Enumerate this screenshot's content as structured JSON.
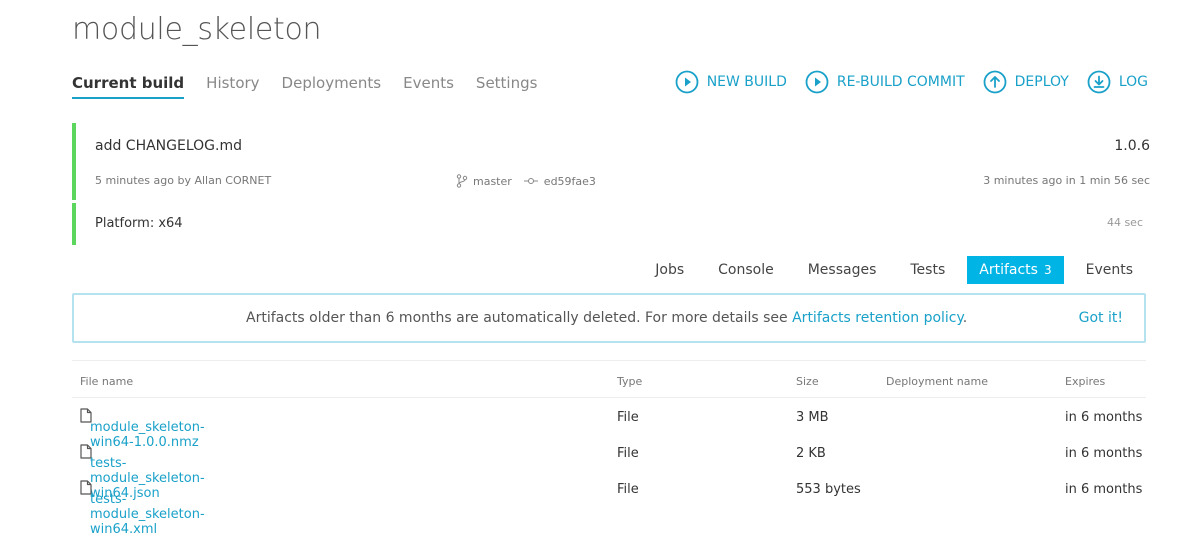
{
  "project": {
    "title": "module_skeleton"
  },
  "nav": {
    "tabs": [
      {
        "label": "Current build",
        "active": true
      },
      {
        "label": "History"
      },
      {
        "label": "Deployments"
      },
      {
        "label": "Events"
      },
      {
        "label": "Settings"
      }
    ]
  },
  "actions": [
    {
      "label": "NEW BUILD",
      "icon": "play-circle-icon"
    },
    {
      "label": "RE-BUILD COMMIT",
      "icon": "play-circle-icon"
    },
    {
      "label": "DEPLOY",
      "icon": "upload-circle-icon"
    },
    {
      "label": "LOG",
      "icon": "download-circle-icon"
    }
  ],
  "build": {
    "commit_message": "add CHANGELOG.md",
    "version": "1.0.6",
    "committed": "5 minutes ago by Allan CORNET",
    "branch": "master",
    "commit_id": "ed59fae3",
    "finished": "3 minutes ago in 1 min 56 sec",
    "platform": "Platform: x64",
    "platform_duration": "44 sec",
    "status_color": "#5cd65c"
  },
  "subtabs": [
    {
      "label": "Jobs"
    },
    {
      "label": "Console"
    },
    {
      "label": "Messages"
    },
    {
      "label": "Tests"
    },
    {
      "label": "Artifacts",
      "count": "3",
      "active": true
    },
    {
      "label": "Events"
    }
  ],
  "banner": {
    "text": "Artifacts older than 6 months are automatically deleted. For more details see",
    "link": "Artifacts retention policy",
    "suffix": ".",
    "dismiss": "Got it!"
  },
  "artifacts": {
    "columns": {
      "name": "File name",
      "type": "Type",
      "size": "Size",
      "deployment": "Deployment name",
      "expires": "Expires"
    },
    "rows": [
      {
        "name": "module_skeleton-win64-1.0.0.nmz",
        "type": "File",
        "size": "3 MB",
        "deployment": "",
        "expires": "in 6 months"
      },
      {
        "name": "tests-module_skeleton-win64.json",
        "type": "File",
        "size": "2 KB",
        "deployment": "",
        "expires": "in 6 months"
      },
      {
        "name": "tests-module_skeleton-win64.xml",
        "type": "File",
        "size": "553 bytes",
        "deployment": "",
        "expires": "in 6 months"
      }
    ]
  },
  "colors": {
    "accent": "#1aa1c9",
    "active_tab_bg": "#00b4e6",
    "success": "#5cd65c"
  }
}
